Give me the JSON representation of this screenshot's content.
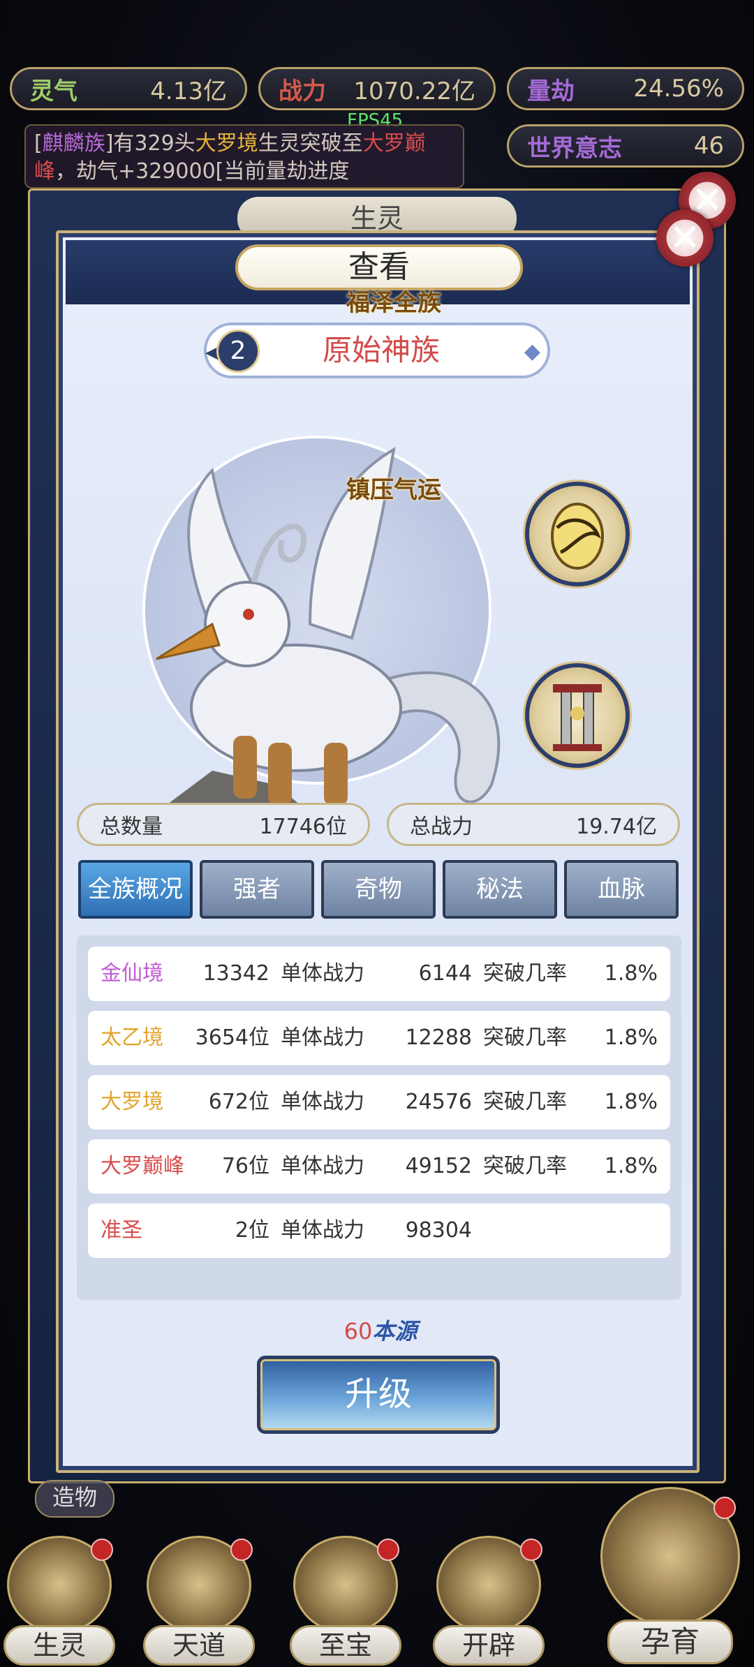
{
  "topbar": {
    "lingqi": {
      "label": "灵气",
      "value": "4.13亿"
    },
    "zhanli": {
      "label": "战力",
      "value": "1070.22亿"
    },
    "liangjie": {
      "label": "量劫",
      "value": "24.56%"
    },
    "world_will": {
      "label": "世界意志",
      "value": "46"
    },
    "fps": "FPS45",
    "ticker": {
      "p1": "[",
      "race": "麒麟族",
      "p2": "]有329头",
      "realm": "大罗境",
      "p3": "生灵突破至",
      "realm2": "大罗巅峰",
      "p4": "，劫气+329000[当前量劫进度"
    }
  },
  "back_panel": {
    "tab": "生灵"
  },
  "dialog": {
    "title": "查看",
    "race_index": "2",
    "race_name": "原始神族",
    "badges": [
      {
        "title": "福泽全族",
        "icon": "golden-egg-icon"
      },
      {
        "title": "镇压气运",
        "icon": "pillar-seal-icon"
      }
    ],
    "stats": {
      "total_count_label": "总数量",
      "total_count": "17746位",
      "total_power_label": "总战力",
      "total_power": "19.74亿"
    },
    "tabs": [
      "全族概况",
      "强者",
      "奇物",
      "秘法",
      "血脉"
    ],
    "active_tab": "全族概况",
    "rows": [
      {
        "realm": "金仙境",
        "color": "#c25bd6",
        "count": "13342位",
        "power_label": "单体战力",
        "power": "6144",
        "rate_label": "突破几率",
        "rate": "1.8%"
      },
      {
        "realm": "太乙境",
        "color": "#e3a32a",
        "count": "3654位",
        "power_label": "单体战力",
        "power": "12288",
        "rate_label": "突破几率",
        "rate": "1.8%"
      },
      {
        "realm": "大罗境",
        "color": "#e3a32a",
        "count": "672位",
        "power_label": "单体战力",
        "power": "24576",
        "rate_label": "突破几率",
        "rate": "1.8%"
      },
      {
        "realm": "大罗巅峰",
        "color": "#d84c4c",
        "count": "76位",
        "power_label": "单体战力",
        "power": "49152",
        "rate_label": "突破几率",
        "rate": "1.8%"
      },
      {
        "realm": "准圣",
        "color": "#d84c4c",
        "count": "2位",
        "power_label": "单体战力",
        "power": "98304",
        "rate_label": "",
        "rate": ""
      }
    ],
    "cost_amount": "60",
    "cost_unit": "本源",
    "upgrade_label": "升级"
  },
  "side_label": "造物",
  "nav": [
    {
      "label": "生灵",
      "has_dot": true
    },
    {
      "label": "天道",
      "has_dot": true
    },
    {
      "label": "至宝",
      "has_dot": true
    },
    {
      "label": "开辟",
      "has_dot": true
    },
    {
      "label": "孕育",
      "has_dot": true
    }
  ]
}
